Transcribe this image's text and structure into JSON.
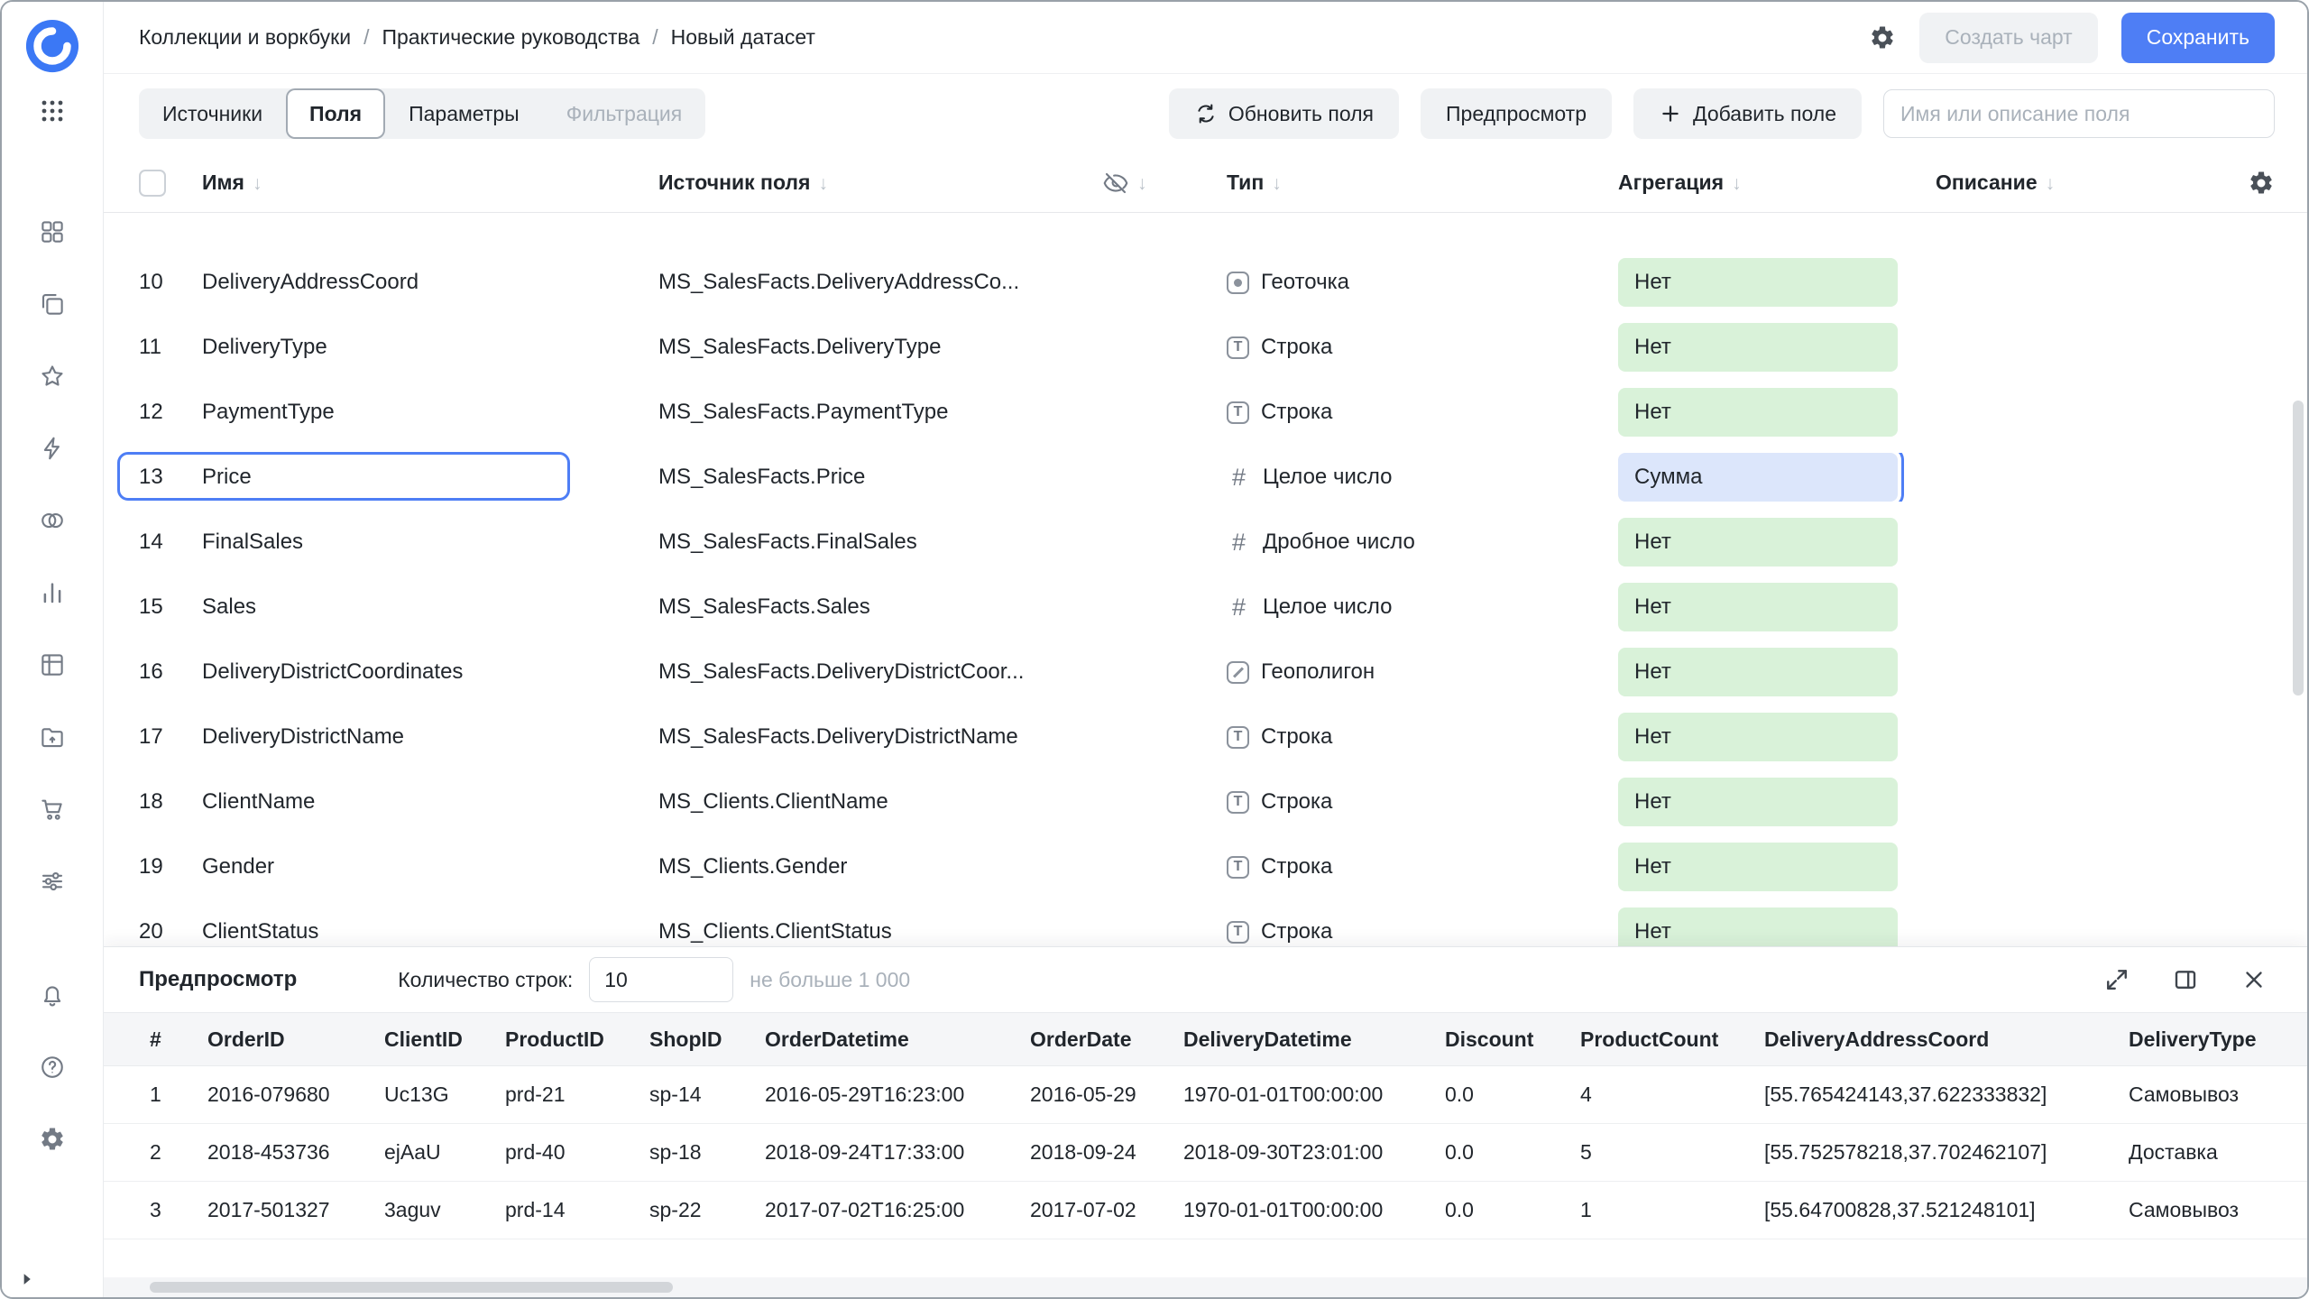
{
  "colors": {
    "accent": "#4e7ef5",
    "badge_green": "#d9f2d9",
    "badge_selected": "#dce6fb",
    "icon_gray": "#737a85"
  },
  "sidebar": {
    "icons": [
      "datalens-logo",
      "apps-grid",
      "dashboards",
      "workbooks",
      "favorites",
      "editor",
      "connections",
      "charts",
      "datasets",
      "storage",
      "marketplace",
      "services",
      "notifications-bell",
      "help",
      "settings-gear",
      "collapse-arrow"
    ]
  },
  "header": {
    "breadcrumb": [
      "Коллекции и воркбуки",
      "Практические руководства",
      "Новый датасет"
    ],
    "separator": "/",
    "create_chart_label": "Создать чарт",
    "save_label": "Сохранить"
  },
  "toolbar": {
    "tabs": [
      {
        "key": "sources",
        "label": "Источники",
        "state": ""
      },
      {
        "key": "fields",
        "label": "Поля",
        "state": "active"
      },
      {
        "key": "parameters",
        "label": "Параметры",
        "state": ""
      },
      {
        "key": "filtering",
        "label": "Фильтрация",
        "state": "disabled"
      }
    ],
    "refresh_fields": "Обновить поля",
    "preview_label": "Предпросмотр",
    "add_field": "Добавить поле",
    "search_placeholder": "Имя или описание поля"
  },
  "fields_table": {
    "headers": {
      "name": "Имя",
      "source": "Источник поля",
      "type": "Тип",
      "aggregation": "Агрегация",
      "description": "Описание"
    },
    "rows": [
      {
        "num": "10",
        "name": "DeliveryAddressCoord",
        "source": "MS_SalesFacts.DeliveryAddressCo...",
        "type": "Геоточка",
        "type_icon": "geopoint",
        "aggregation": "Нет",
        "selected": false,
        "aggregation_selected": false
      },
      {
        "num": "11",
        "name": "DeliveryType",
        "source": "MS_SalesFacts.DeliveryType",
        "type": "Строка",
        "type_icon": "string",
        "aggregation": "Нет",
        "selected": false,
        "aggregation_selected": false
      },
      {
        "num": "12",
        "name": "PaymentType",
        "source": "MS_SalesFacts.PaymentType",
        "type": "Строка",
        "type_icon": "string",
        "aggregation": "Нет",
        "selected": false,
        "aggregation_selected": false
      },
      {
        "num": "13",
        "name": "Price",
        "source": "MS_SalesFacts.Price",
        "type": "Целое число",
        "type_icon": "integer",
        "aggregation": "Сумма",
        "selected": true,
        "aggregation_selected": true
      },
      {
        "num": "14",
        "name": "FinalSales",
        "source": "MS_SalesFacts.FinalSales",
        "type": "Дробное число",
        "type_icon": "float",
        "aggregation": "Нет",
        "selected": false,
        "aggregation_selected": false
      },
      {
        "num": "15",
        "name": "Sales",
        "source": "MS_SalesFacts.Sales",
        "type": "Целое число",
        "type_icon": "integer",
        "aggregation": "Нет",
        "selected": false,
        "aggregation_selected": false
      },
      {
        "num": "16",
        "name": "DeliveryDistrictCoordinates",
        "source": "MS_SalesFacts.DeliveryDistrictCoor...",
        "type": "Геополигон",
        "type_icon": "geopolygon",
        "aggregation": "Нет",
        "selected": false,
        "aggregation_selected": false
      },
      {
        "num": "17",
        "name": "DeliveryDistrictName",
        "source": "MS_SalesFacts.DeliveryDistrictName",
        "type": "Строка",
        "type_icon": "string",
        "aggregation": "Нет",
        "selected": false,
        "aggregation_selected": false
      },
      {
        "num": "18",
        "name": "ClientName",
        "source": "MS_Clients.ClientName",
        "type": "Строка",
        "type_icon": "string",
        "aggregation": "Нет",
        "selected": false,
        "aggregation_selected": false
      },
      {
        "num": "19",
        "name": "Gender",
        "source": "MS_Clients.Gender",
        "type": "Строка",
        "type_icon": "string",
        "aggregation": "Нет",
        "selected": false,
        "aggregation_selected": false
      },
      {
        "num": "20",
        "name": "ClientStatus",
        "source": "MS_Clients.ClientStatus",
        "type": "Строка",
        "type_icon": "string",
        "aggregation": "Нет",
        "selected": false,
        "aggregation_selected": false
      }
    ]
  },
  "preview": {
    "title": "Предпросмотр",
    "row_count_label": "Количество строк:",
    "row_count_value": "10",
    "row_count_hint": "не больше 1 000",
    "columns": [
      "#",
      "OrderID",
      "ClientID",
      "ProductID",
      "ShopID",
      "OrderDatetime",
      "OrderDate",
      "DeliveryDatetime",
      "Discount",
      "ProductCount",
      "DeliveryAddressCoord",
      "DeliveryType"
    ],
    "rows": [
      [
        "1",
        "2016-079680",
        "Uc13G",
        "prd-21",
        "sp-14",
        "2016-05-29T16:23:00",
        "2016-05-29",
        "1970-01-01T00:00:00",
        "0.0",
        "4",
        "[55.765424143,37.622333832]",
        "Самовывоз"
      ],
      [
        "2",
        "2018-453736",
        "ejAaU",
        "prd-40",
        "sp-18",
        "2018-09-24T17:33:00",
        "2018-09-24",
        "2018-09-30T23:01:00",
        "0.0",
        "5",
        "[55.752578218,37.702462107]",
        "Доставка"
      ],
      [
        "3",
        "2017-501327",
        "3aguv",
        "prd-14",
        "sp-22",
        "2017-07-02T16:25:00",
        "2017-07-02",
        "1970-01-01T00:00:00",
        "0.0",
        "1",
        "[55.64700828,37.521248101]",
        "Самовывоз"
      ]
    ]
  }
}
